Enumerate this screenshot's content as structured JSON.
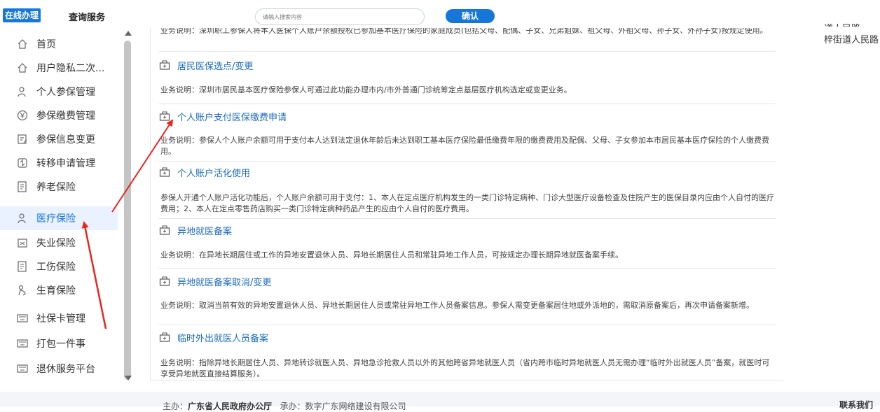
{
  "header": {
    "tab_online": "在线办理",
    "tab_query": "查询服务",
    "search_placeholder": "请输入搜索内容",
    "confirm_label": "确认"
  },
  "sidebar": {
    "items": [
      {
        "label": "首页",
        "icon": "home-icon"
      },
      {
        "label": "用户隐私二次...",
        "icon": "home-icon"
      },
      {
        "label": "个人参保管理",
        "icon": "person-icon"
      },
      {
        "label": "参保缴费管理",
        "icon": "yuan-icon"
      },
      {
        "label": "参保信息变更",
        "icon": "edit-doc-icon"
      },
      {
        "label": "转移申请管理",
        "icon": "transfer-icon"
      },
      {
        "label": "养老保险",
        "icon": "document-icon"
      },
      {
        "label": "医疗保险",
        "icon": "person-icon"
      },
      {
        "label": "失业保险",
        "icon": "unemployment-icon"
      },
      {
        "label": "工伤保险",
        "icon": "document-icon"
      },
      {
        "label": "生育保险",
        "icon": "maternity-icon"
      },
      {
        "label": "社保卡管理",
        "icon": "card-icon"
      },
      {
        "label": "打包一件事",
        "icon": "card-icon"
      },
      {
        "label": "退休服务平台",
        "icon": "card-icon"
      }
    ],
    "active_index": 7
  },
  "content": {
    "top_partial": "业务说明：深圳职工参保人将本人医保个人账户余额授权已参加基本医疗保险的家庭成员(包括父母、配偶、子女、兄弟姐妹、祖父母、外祖父母、孙子女、外孙子女)按规定使用。",
    "cards": [
      {
        "title": "居民医保选点/变更",
        "desc": "业务说明：深圳市居民基本医疗保险参保人可通过此功能办理市内/市外普通门诊统筹定点基层医疗机构选定或变更业务。"
      },
      {
        "title": "个人账户支付医保缴费申请",
        "desc": "业务说明：参保人个人账户余额可用于支付本人达到法定退休年龄后未达到职工基本医疗保险最低缴费年限的缴费费用及配偶、父母、子女参加本市居民基本医疗保险的个人缴费费用。"
      },
      {
        "title": "个人账户活化使用",
        "desc": "参保人开通个人账户活化功能后，个人账户余额可用于支付：1、本人在定点医疗机构发生的一类门诊特定病种、门诊大型医疗设备检查及住院产生的医保目录内应由个人自付的医疗费用；2、本人在定点零售药店购买一类门诊特定病种药品产生的应由个人自付的医疗费用。"
      },
      {
        "title": "异地就医备案",
        "desc": "业务说明：在异地长期居住或工作的异地安置退休人员、异地长期居住人员和常驻异地工作人员，可按规定办理长期异地就医备案手续。"
      },
      {
        "title": "异地就医备案取消/变更",
        "desc": "业务说明：取消当前有效的异地安置退休人员、异地长期居住人员或常驻异地工作人员备案信息。参保人需变更备案居住地或外派地的，需取消原备案后，再次申请备案新增。"
      },
      {
        "title": "临时外出就医人员备案",
        "desc": "业务说明：指除异地长期居住人员、异地转诊就医人员、异地急诊抢救人员以外的其他跨省异地就医人员（省内跨市临时异地就医人员无需办理“临时外出就医人员”备案，就医时可享受异地就医直接结算服务）。"
      }
    ]
  },
  "right_cut": {
    "line1": "梓街道人民路",
    "line0": "道人民路"
  },
  "footer": {
    "host_label": "主办：",
    "host_name": "广东省人民政府办公厅",
    "organizer_label": "承办：",
    "organizer_name": "数字广东网络建设有限公司",
    "contact": "联系我们"
  },
  "colors": {
    "accent": "#1677d8",
    "link": "#1b6bbf",
    "annotation": "#e8261e"
  }
}
